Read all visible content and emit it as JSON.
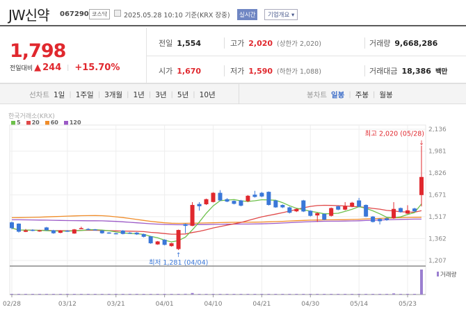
{
  "header": {
    "name": "JW신약",
    "code": "067290",
    "market": "코스닥",
    "datetime": "2025.05.28 10:10 기준(KRX 장중)",
    "realtime": "실시간",
    "company_info": "기업개요 ▾"
  },
  "quote": {
    "price": "1,798",
    "change_label": "전일대비",
    "change_arrow": "▲",
    "change": "244",
    "change_pct": "+15.70%",
    "prev_label": "전일",
    "prev": "1,554",
    "open_label": "시가",
    "open": "1,670",
    "high_label": "고가",
    "high": "2,020",
    "upper_limit": "(상한가 2,020)",
    "low_label": "저가",
    "low": "1,590",
    "lower_limit": "(하한가 1,088)",
    "volume_label": "거래량",
    "volume": "9,668,286",
    "amount_label": "거래대금",
    "amount": "18,386",
    "amount_unit": "백만"
  },
  "tabs": {
    "line_label": "선차트",
    "line": [
      "1일",
      "1주일",
      "3개월",
      "1년",
      "3년",
      "5년",
      "10년"
    ],
    "candle_label": "봉차트",
    "candle": [
      "일봉",
      "주봉",
      "월봉"
    ],
    "candle_active": 0
  },
  "chart_data": {
    "type": "candlestick",
    "source": "한국거래소(KRX)",
    "legend": [
      {
        "name": "5",
        "color": "#6cc04a"
      },
      {
        "name": "20",
        "color": "#e04848"
      },
      {
        "name": "60",
        "color": "#f08c28"
      },
      {
        "name": "120",
        "color": "#9b59c6"
      }
    ],
    "yticks": [
      "2,136",
      "1,981",
      "1,826",
      "1,671",
      "1,517",
      "1,362",
      "1,207"
    ],
    "ylim": [
      1207,
      2136
    ],
    "xticks": [
      {
        "label": "02/28",
        "index": 0
      },
      {
        "label": "03/12",
        "index": 8
      },
      {
        "label": "03/21",
        "index": 15
      },
      {
        "label": "04/01",
        "index": 22
      },
      {
        "label": "04/10",
        "index": 29
      },
      {
        "label": "04/21",
        "index": 36
      },
      {
        "label": "04/30",
        "index": 43
      },
      {
        "label": "05/14",
        "index": 50
      },
      {
        "label": "05/23",
        "index": 57
      }
    ],
    "high_note": "최고 2,020 (05/28)",
    "low_note": "최저 1,281 (04/04)",
    "volume_label": "거래량",
    "up_color": "#e0282e",
    "down_color": "#3a77d8",
    "ohlc": [
      [
        1477,
        1436,
        1482,
        1428
      ],
      [
        1468,
        1411,
        1470,
        1405
      ],
      [
        1410,
        1420,
        1430,
        1408
      ],
      [
        1424,
        1418,
        1428,
        1414
      ],
      [
        1413,
        1420,
        1424,
        1410
      ],
      [
        1441,
        1421,
        1445,
        1418
      ],
      [
        1421,
        1400,
        1424,
        1396
      ],
      [
        1403,
        1419,
        1422,
        1400
      ],
      [
        1418,
        1414,
        1422,
        1410
      ],
      [
        1398,
        1427,
        1430,
        1396
      ],
      [
        1433,
        1436,
        1446,
        1430
      ],
      [
        1430,
        1427,
        1436,
        1424
      ],
      [
        1427,
        1423,
        1430,
        1420
      ],
      [
        1419,
        1400,
        1422,
        1396
      ],
      [
        1405,
        1400,
        1408,
        1396
      ],
      [
        1400,
        1396,
        1403,
        1392
      ],
      [
        1419,
        1395,
        1422,
        1392
      ],
      [
        1404,
        1400,
        1408,
        1396
      ],
      [
        1404,
        1392,
        1408,
        1388
      ],
      [
        1394,
        1375,
        1398,
        1370
      ],
      [
        1378,
        1329,
        1380,
        1325
      ],
      [
        1321,
        1342,
        1345,
        1318
      ],
      [
        1354,
        1318,
        1358,
        1314
      ],
      [
        1309,
        1329,
        1332,
        1305
      ],
      [
        1288,
        1423,
        1426,
        1281
      ],
      [
        1465,
        1452,
        1468,
        1400
      ],
      [
        1452,
        1600,
        1620,
        1450
      ],
      [
        1607,
        1591,
        1620,
        1560
      ],
      [
        1605,
        1641,
        1645,
        1600
      ],
      [
        1621,
        1686,
        1690,
        1618
      ],
      [
        1686,
        1632,
        1705,
        1628
      ],
      [
        1641,
        1624,
        1648,
        1620
      ],
      [
        1629,
        1608,
        1632,
        1604
      ],
      [
        1632,
        1595,
        1636,
        1590
      ],
      [
        1627,
        1665,
        1670,
        1620
      ],
      [
        1673,
        1657,
        1700,
        1652
      ],
      [
        1686,
        1660,
        1692,
        1655
      ],
      [
        1693,
        1600,
        1696,
        1596
      ],
      [
        1632,
        1583,
        1636,
        1580
      ],
      [
        1600,
        1583,
        1604,
        1578
      ],
      [
        1583,
        1545,
        1588,
        1540
      ],
      [
        1555,
        1572,
        1576,
        1550
      ],
      [
        1632,
        1554,
        1636,
        1550
      ],
      [
        1559,
        1523,
        1562,
        1518
      ],
      [
        1526,
        1542,
        1546,
        1480
      ],
      [
        1537,
        1496,
        1540,
        1492
      ],
      [
        1523,
        1578,
        1582,
        1518
      ],
      [
        1591,
        1567,
        1595,
        1562
      ],
      [
        1567,
        1591,
        1620,
        1562
      ],
      [
        1588,
        1616,
        1622,
        1584
      ],
      [
        1632,
        1588,
        1650,
        1584
      ],
      [
        1600,
        1518,
        1604,
        1514
      ],
      [
        1518,
        1480,
        1522,
        1476
      ],
      [
        1501,
        1485,
        1506,
        1462
      ],
      [
        1505,
        1493,
        1510,
        1488
      ],
      [
        1506,
        1572,
        1620,
        1502
      ],
      [
        1578,
        1550,
        1582,
        1546
      ],
      [
        1539,
        1562,
        1598,
        1536
      ],
      [
        1575,
        1555,
        1580,
        1550
      ],
      [
        1670,
        1798,
        2020,
        1590
      ]
    ],
    "ma60": [
      [
        0,
        1510
      ],
      [
        12,
        1525
      ],
      [
        24,
        1470
      ],
      [
        34,
        1478
      ],
      [
        46,
        1495
      ],
      [
        59,
        1513
      ]
    ],
    "ma120": [
      [
        0,
        1495
      ],
      [
        12,
        1488
      ],
      [
        24,
        1460
      ],
      [
        34,
        1465
      ],
      [
        46,
        1485
      ],
      [
        59,
        1500
      ]
    ],
    "volume": [
      60000,
      40000,
      30000,
      30000,
      30000,
      30000,
      30000,
      30000,
      30000,
      30000,
      30000,
      30000,
      30000,
      30000,
      30000,
      30000,
      30000,
      30000,
      30000,
      30000,
      30000,
      30000,
      30000,
      30000,
      150000,
      300000,
      600000,
      150000,
      120000,
      150000,
      150000,
      60000,
      60000,
      120000,
      120000,
      120000,
      150000,
      120000,
      60000,
      60000,
      150000,
      60000,
      150000,
      60000,
      60000,
      60000,
      120000,
      60000,
      150000,
      60000,
      60000,
      120000,
      60000,
      60000,
      60000,
      450000,
      120000,
      60000,
      60000,
      9668286
    ]
  }
}
